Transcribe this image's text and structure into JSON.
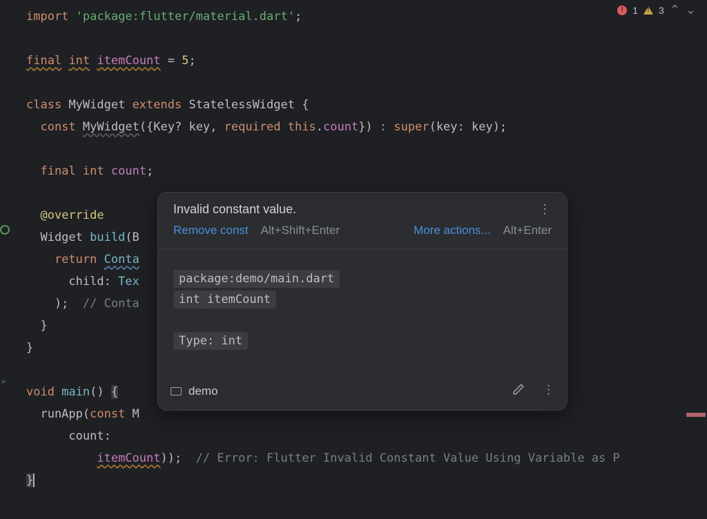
{
  "problems": {
    "errors": "1",
    "warnings": "3"
  },
  "code": {
    "l1a": "import",
    "l1b": "'package:flutter/material.dart'",
    "l1c": ";",
    "l2a": "final",
    "l2b": "int",
    "l2c": "itemCount",
    "l2d": " = ",
    "l2e": "5",
    "l2f": ";",
    "l3a": "class",
    "l3b": "MyWidget ",
    "l3c": "extends",
    "l3d": " StatelessWidget {",
    "l4a": "  ",
    "l4b": "const",
    "l4c": "MyWidget",
    "l4d": "({Key? key, ",
    "l4e": "required",
    "l4f": "this",
    "l4g": ".",
    "l4h": "count",
    "l4i": "}) ",
    "l4j": ":",
    "l4k": "super",
    "l4l": "(key: key);",
    "l5a": "  ",
    "l5b": "final",
    "l5c": "int",
    "l5d": "count",
    "l5e": ";",
    "l6a": "  ",
    "l6b": "@override",
    "l7a": "  Widget ",
    "l7b": "build",
    "l7c": "(B",
    "l8a": "    ",
    "l8b": "return",
    "l8c": "Conta",
    "l9a": "      child: ",
    "l9b": "Tex",
    "l10a": "    );  ",
    "l10b": "// Conta",
    "l11a": "  }",
    "l12a": "}",
    "l13a": "void",
    "l13b": "main",
    "l13c": "() ",
    "l13d": "{",
    "l14a": "  runApp(",
    "l14b": "const",
    "l14c": " M",
    "l15a": "      count:",
    "l16a": "          ",
    "l16b": "itemCount",
    "l16c": "));  ",
    "l16d": "// Error: Flutter Invalid Constant Value Using Variable as P",
    "l17a": "}"
  },
  "popup": {
    "title": "Invalid constant value.",
    "fix": "Remove const",
    "fixHint": "Alt+Shift+Enter",
    "more": "More actions...",
    "moreHint": "Alt+Enter",
    "pkg": "package:demo/main.dart",
    "decl": "int itemCount",
    "typeLabel": "Type: ",
    "type": "int",
    "module": "demo"
  }
}
